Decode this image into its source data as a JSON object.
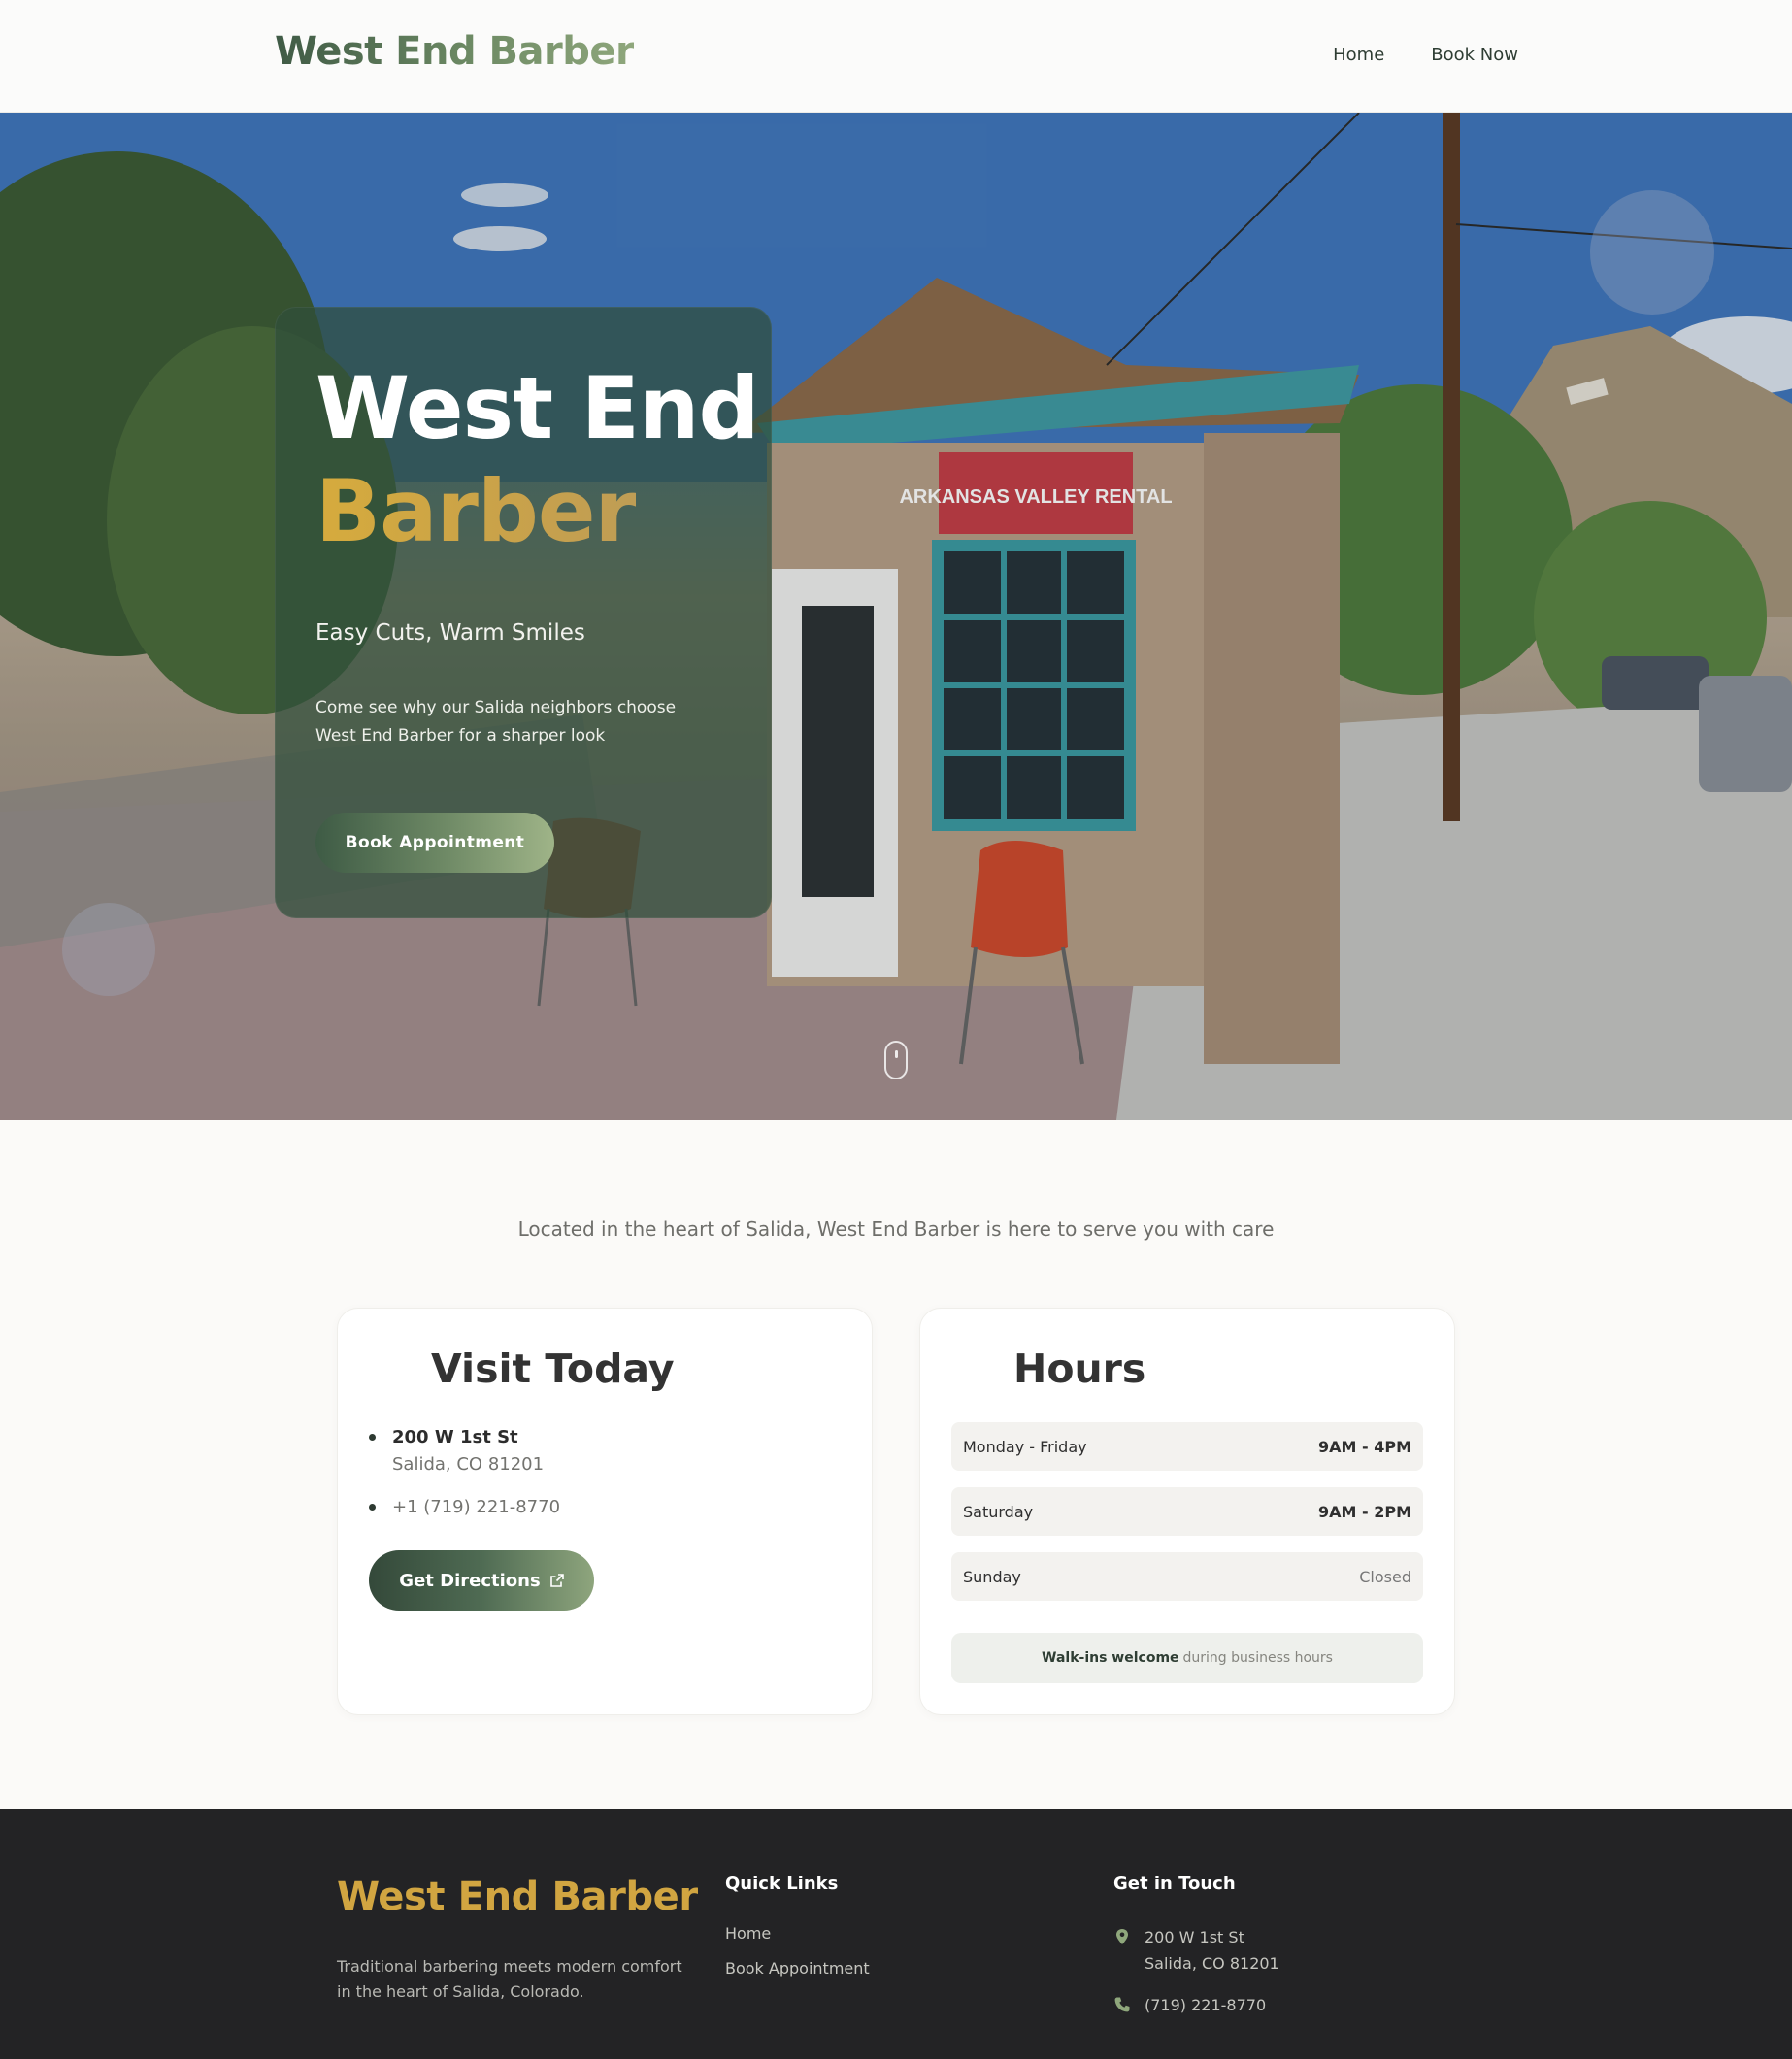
{
  "header": {
    "brand": "West End Barber",
    "nav": [
      {
        "label": "Home"
      },
      {
        "label": "Book Now"
      }
    ]
  },
  "hero": {
    "title_line1": "West End",
    "title_line2": "Barber",
    "subtitle": "Easy Cuts, Warm Smiles",
    "description": "Come see why our Salida neighbors choose West End Barber for a sharper look",
    "cta": "Book Appointment",
    "photo_sign": "ARKANSAS VALLEY RENTAL"
  },
  "info": {
    "tagline": "Located in the heart of Salida, West End Barber is here to serve you with care",
    "visit": {
      "title": "Visit Today",
      "address_line1": "200 W 1st St",
      "address_line2": "Salida, CO 81201",
      "phone": "+1 (719) 221-8770",
      "directions_label": "Get Directions"
    },
    "hours": {
      "title": "Hours",
      "rows": [
        {
          "day": "Monday - Friday",
          "time": "9AM - 4PM"
        },
        {
          "day": "Saturday",
          "time": "9AM - 2PM"
        },
        {
          "day": "Sunday",
          "time": "Closed"
        }
      ],
      "walkin_bold": "Walk-ins welcome",
      "walkin_rest": "during business hours"
    }
  },
  "footer": {
    "brand": "West End Barber",
    "description": "Traditional barbering meets modern comfort in the heart of Salida, Colorado.",
    "quick_links_title": "Quick Links",
    "quick_links": [
      {
        "label": "Home"
      },
      {
        "label": "Book Appointment"
      }
    ],
    "contact_title": "Get in Touch",
    "address_line1": "200 W 1st St",
    "address_line2": "Salida, CO 81201",
    "phone": "(719) 221-8770"
  },
  "colors": {
    "brand_green": "#3f5a45",
    "gold": "#d1a541",
    "footer_bg": "#232325"
  },
  "icons": [
    "external-link-icon",
    "map-pin-icon",
    "phone-icon",
    "scroll-mouse-icon"
  ]
}
